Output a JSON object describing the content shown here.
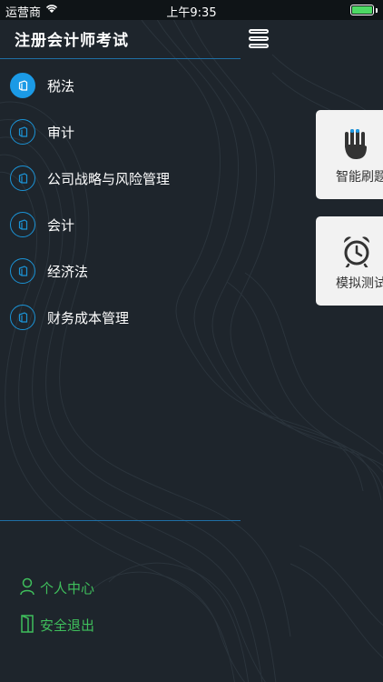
{
  "status_bar": {
    "carrier": "运营商",
    "time": "上午9:35"
  },
  "drawer": {
    "title": "注册会计师考试",
    "subjects": [
      {
        "label": "税法",
        "active": true
      },
      {
        "label": "审计",
        "active": false
      },
      {
        "label": "公司战略与风险管理",
        "active": false
      },
      {
        "label": "会计",
        "active": false
      },
      {
        "label": "经济法",
        "active": false
      },
      {
        "label": "财务成本管理",
        "active": false
      }
    ],
    "footer": {
      "personal_center": "个人中心",
      "logout": "安全退出"
    }
  },
  "main": {
    "cards": [
      {
        "label": "智能刷题",
        "icon": "hand-tap-icon"
      },
      {
        "label": "模拟测试",
        "icon": "alarm-clock-icon"
      }
    ]
  },
  "colors": {
    "background": "#1e252c",
    "accent_blue": "#1b9ae6",
    "divider": "#1f6fa5",
    "footer_green": "#3fbf5c",
    "card_bg": "#f2f2f2"
  }
}
